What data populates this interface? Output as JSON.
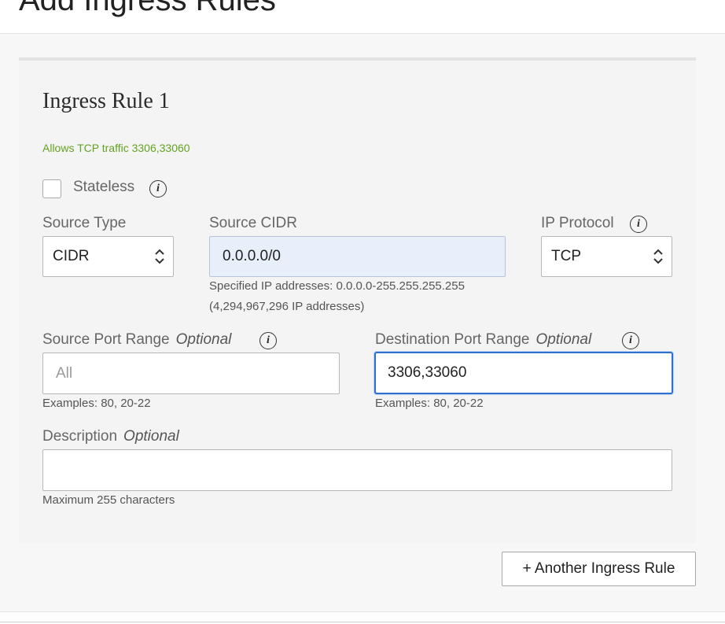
{
  "header": {
    "title": "Add Ingress Rules"
  },
  "rule": {
    "title": "Ingress Rule 1",
    "summary": "Allows TCP traffic 3306,33060",
    "stateless_label": "Stateless",
    "stateless_checked": false,
    "source_type": {
      "label": "Source Type",
      "value": "CIDR"
    },
    "source_cidr": {
      "label": "Source CIDR",
      "value": "0.0.0.0/0",
      "hint_line1": "Specified IP addresses: 0.0.0.0-255.255.255.255",
      "hint_line2": "(4,294,967,296 IP addresses)"
    },
    "ip_protocol": {
      "label": "IP Protocol",
      "value": "TCP"
    },
    "source_port": {
      "label": "Source Port Range",
      "optional": "Optional",
      "placeholder": "All",
      "hint": "Examples: 80, 20-22"
    },
    "destination_port": {
      "label": "Destination Port Range",
      "optional": "Optional",
      "value": "3306,33060",
      "hint": "Examples: 80, 20-22"
    },
    "description": {
      "label": "Description",
      "optional": "Optional",
      "value": "",
      "hint": "Maximum 255 characters"
    }
  },
  "actions": {
    "another_rule": "+ Another Ingress Rule"
  },
  "icons": {
    "info": "info-icon",
    "chevron": "chevron-up-down-icon"
  },
  "colors": {
    "success": "#62a420",
    "focus": "#2f6fcf",
    "cidr_bg": "#e8effa"
  }
}
